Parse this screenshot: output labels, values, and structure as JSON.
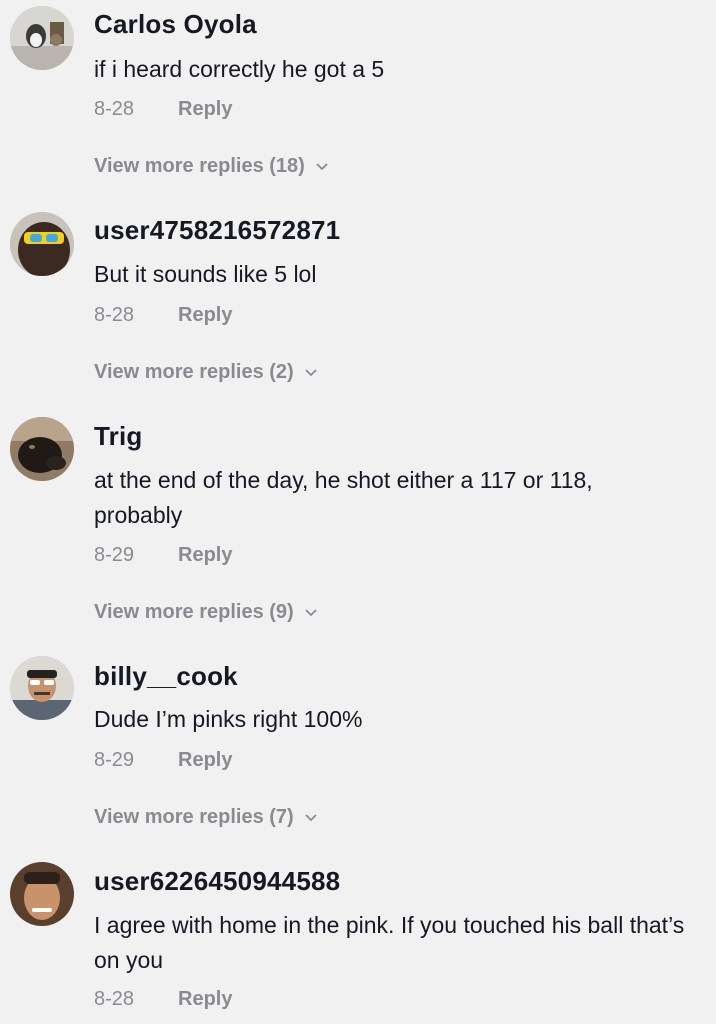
{
  "comments": [
    {
      "username": "Carlos Oyola",
      "text": "if i heard correctly he got a 5",
      "date": "8-28",
      "reply_label": "Reply",
      "more_replies": "View more replies (18)"
    },
    {
      "username": "user4758216572871",
      "text": "But it sounds like 5 lol",
      "date": "8-28",
      "reply_label": "Reply",
      "more_replies": "View more replies (2)"
    },
    {
      "username": "Trig",
      "text": "at the end of the day, he shot either a 117 or 118, probably",
      "date": "8-29",
      "reply_label": "Reply",
      "more_replies": "View more replies (9)"
    },
    {
      "username": "billy__cook",
      "text": "Dude I’m pinks right 100%",
      "date": "8-29",
      "reply_label": "Reply",
      "more_replies": "View more replies (7)"
    },
    {
      "username": "user6226450944588",
      "text": "I agree with home in the pink. If you touched his ball that’s on you",
      "date": "8-28",
      "reply_label": "Reply"
    }
  ],
  "colors": {
    "background": "#f1f1f2",
    "username": "#161823",
    "secondary": "#8a8b91"
  },
  "icons": {
    "expand": "chevron-down-icon"
  }
}
